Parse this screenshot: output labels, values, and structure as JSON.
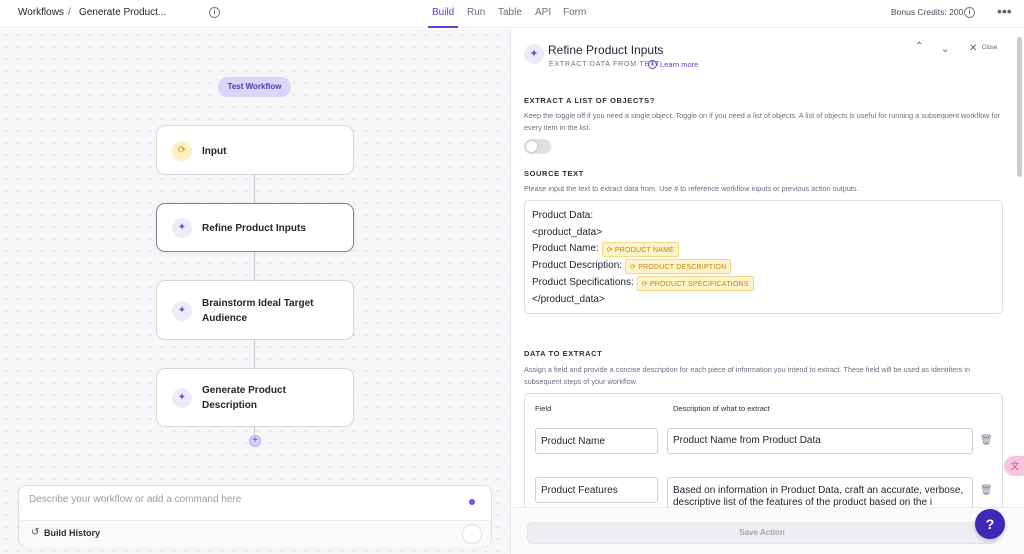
{
  "topbar": {
    "breadcrumb_root": "Workflows",
    "breadcrumb_sep": "/",
    "breadcrumb_current": "Generate Product...",
    "tabs": [
      "Build",
      "Run",
      "Table",
      "API",
      "Form"
    ],
    "active_tab": "Build",
    "credits": "Bonus Credits: 200",
    "more": "•••"
  },
  "canvas": {
    "test_button": "Test Workflow",
    "nodes": [
      {
        "label": "Input",
        "icon": "input-icon"
      },
      {
        "label": "Refine Product Inputs",
        "icon": "wand-icon"
      },
      {
        "label": "Brainstorm Ideal Target Audience",
        "icon": "sparkle-icon"
      },
      {
        "label": "Generate Product Description",
        "icon": "sparkle-icon"
      }
    ],
    "chat_placeholder": "Describe your workflow or add a command here",
    "build_history": "Build History"
  },
  "panel": {
    "title": "Refine Product Inputs",
    "subtitle": "EXTRACT DATA FROM TEXT",
    "learn_more": "Learn more",
    "close": "Close",
    "extract_list_title": "EXTRACT A LIST OF OBJECTS?",
    "extract_list_desc": "Keep the toggle off if you need a single object. Toggle on if you need a list of objects. A list of objects is useful for running a subsequent workflow for every item in the list.",
    "extract_list_toggle": false,
    "source_title": "SOURCE TEXT",
    "source_desc": "Please input the text to extract data from. Use # to reference workflow inputs or previous action outputs.",
    "source_lines": [
      {
        "text": "Product Data:"
      },
      {
        "text": "<product_data>"
      },
      {
        "text": "Product Name:",
        "chip": "PRODUCT NAME"
      },
      {
        "text": "Product Description:",
        "chip": "PRODUCT DESCRIPTION"
      },
      {
        "text": "Product Specifications:",
        "chip": "PRODUCT SPECIFICATIONS"
      },
      {
        "text": "</product_data>"
      }
    ],
    "data_title": "DATA TO EXTRACT",
    "data_desc": "Assign a field and provide a concise description for each piece of information you intend to extract. These field will be used as identifiers in subsequent steps of your workflow.",
    "col_field": "Field",
    "col_desc": "Description of what to extract",
    "rows": [
      {
        "field": "Product Name",
        "description": "Product Name from Product Data"
      },
      {
        "field": "Product Features",
        "description": "Based on information in Product Data, craft an accurate, verbose, descriptive list of the features of the product based on the i"
      }
    ],
    "save_action": "Save Action"
  },
  "help": "?",
  "colors": {
    "accent": "#5b43d6",
    "chip_bg": "#fff3c9",
    "help_bg": "#3f28b8"
  }
}
